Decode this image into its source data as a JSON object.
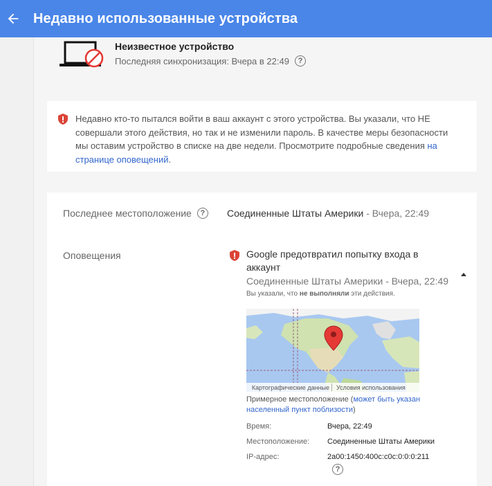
{
  "header": {
    "title": "Недавно использованные устройства",
    "background": "#4a86e8"
  },
  "device": {
    "name": "Неизвестное устройство",
    "sync_text": "Последняя синхронизация: Вчера в 22:49",
    "icon": "unknown-laptop-icon"
  },
  "alert": {
    "text": "Недавно кто-то пытался войти в ваш аккаунт с этого устройства. Вы указали, что НЕ совершали этого действия, но так и не изменили пароль. В качестве меры безопасности мы оставим устройство в списке на две недели. Просмотрите подробные сведения ",
    "link_text": "на странице оповещений",
    "after_link": ".",
    "accent": "#db4437"
  },
  "details": {
    "last_location_label": "Последнее местоположение",
    "last_location_country": "Соединенные Штаты Америки",
    "last_location_time": " - Вчера, 22:49",
    "notifications_label": "Оповещения",
    "notification": {
      "title": "Google предотвратил попытку входа в аккаунт",
      "location": "Соединенные Штаты Америки - Вчера, 22:49",
      "note_prefix": "Вы указали, что ",
      "note_bold": "не выполняли",
      "note_suffix": " эти действия."
    },
    "map": {
      "data_label": "Картографические данные",
      "terms_label": "Условия использования"
    },
    "approx": {
      "prefix": "Примерное местоположение (",
      "link": "может быть указан населенный пункт поблизости",
      "suffix": ")"
    },
    "fields": {
      "time_label": "Время:",
      "time_value": "Вчера, 22:49",
      "location_label": "Местоположение:",
      "location_value": "Соединенные Штаты Америки",
      "ip_label": "IP-адрес:",
      "ip_value": "2a00:1450:400c:c0c:0:0:0:211"
    }
  }
}
